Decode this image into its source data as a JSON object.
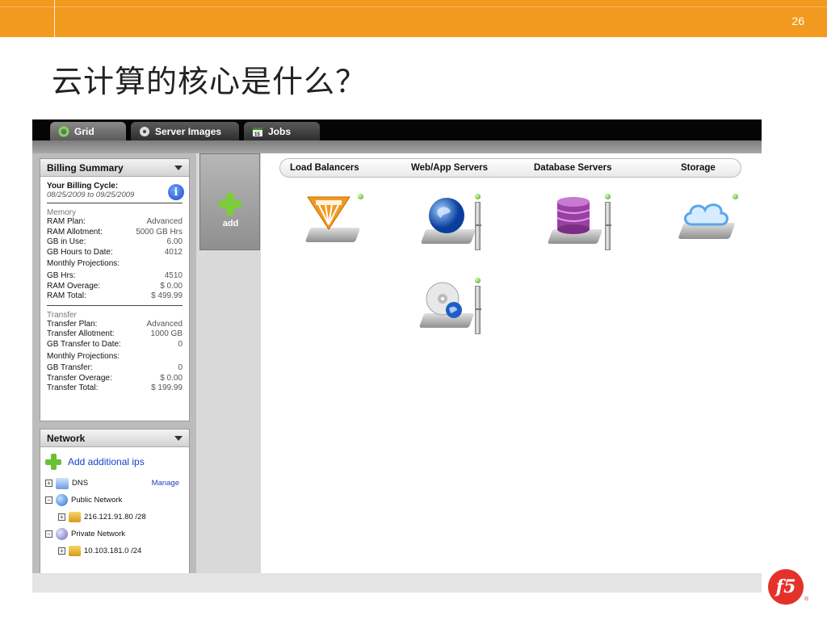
{
  "page_number": "26",
  "slide_title": "云计算的核心是什么？",
  "tabs": [
    {
      "label": "Grid",
      "icon": "ring-icon",
      "active": true
    },
    {
      "label": "Server Images",
      "icon": "disc-icon"
    },
    {
      "label": "Jobs",
      "icon": "calendar-icon"
    }
  ],
  "billing": {
    "header": "Billing Summary",
    "cycle_title": "Your Billing Cycle:",
    "cycle_dates": "08/25/2009 to 09/25/2009",
    "memory_label": "Memory",
    "memory_rows": [
      {
        "k": "RAM Plan:",
        "v": "Advanced"
      },
      {
        "k": "RAM Allotment:",
        "v": "5000 GB Hrs"
      },
      {
        "k": "GB in Use:",
        "v": "6.00"
      },
      {
        "k": "GB Hours to Date:",
        "v": "4012"
      },
      {
        "k": "Monthly Projections:",
        "v": ""
      },
      {
        "k": "GB Hrs:",
        "v": "4510"
      },
      {
        "k": "RAM Overage:",
        "v": "$ 0.00"
      },
      {
        "k": "RAM Total:",
        "v": "$ 499.99"
      }
    ],
    "transfer_label": "Transfer",
    "transfer_rows": [
      {
        "k": "Transfer Plan:",
        "v": "Advanced"
      },
      {
        "k": "Transfer Allotment:",
        "v": "1000 GB"
      },
      {
        "k": "GB Transfer to Date:",
        "v": "0"
      },
      {
        "k": "Monthly Projections:",
        "v": ""
      },
      {
        "k": "GB Transfer:",
        "v": "0"
      },
      {
        "k": "Transfer Overage:",
        "v": "$ 0.00"
      },
      {
        "k": "Transfer Total:",
        "v": "$ 199.99"
      }
    ]
  },
  "network": {
    "header": "Network",
    "add_label": "Add additional ips",
    "items": [
      {
        "label": "DNS",
        "action": "Manage"
      },
      {
        "label": "Public Network"
      },
      {
        "label": "216.121.91.80 /28"
      },
      {
        "label": "Private Network"
      },
      {
        "label": "10.103.181.0 /24"
      }
    ]
  },
  "add_tile_label": "add",
  "categories": [
    "Load Balancers",
    "Web/App Servers",
    "Database Servers",
    "Storage"
  ],
  "colors": {
    "accent": "#f29a1f",
    "brand": "#e4322b",
    "status_ok": "#39a112"
  },
  "logo": "f5"
}
